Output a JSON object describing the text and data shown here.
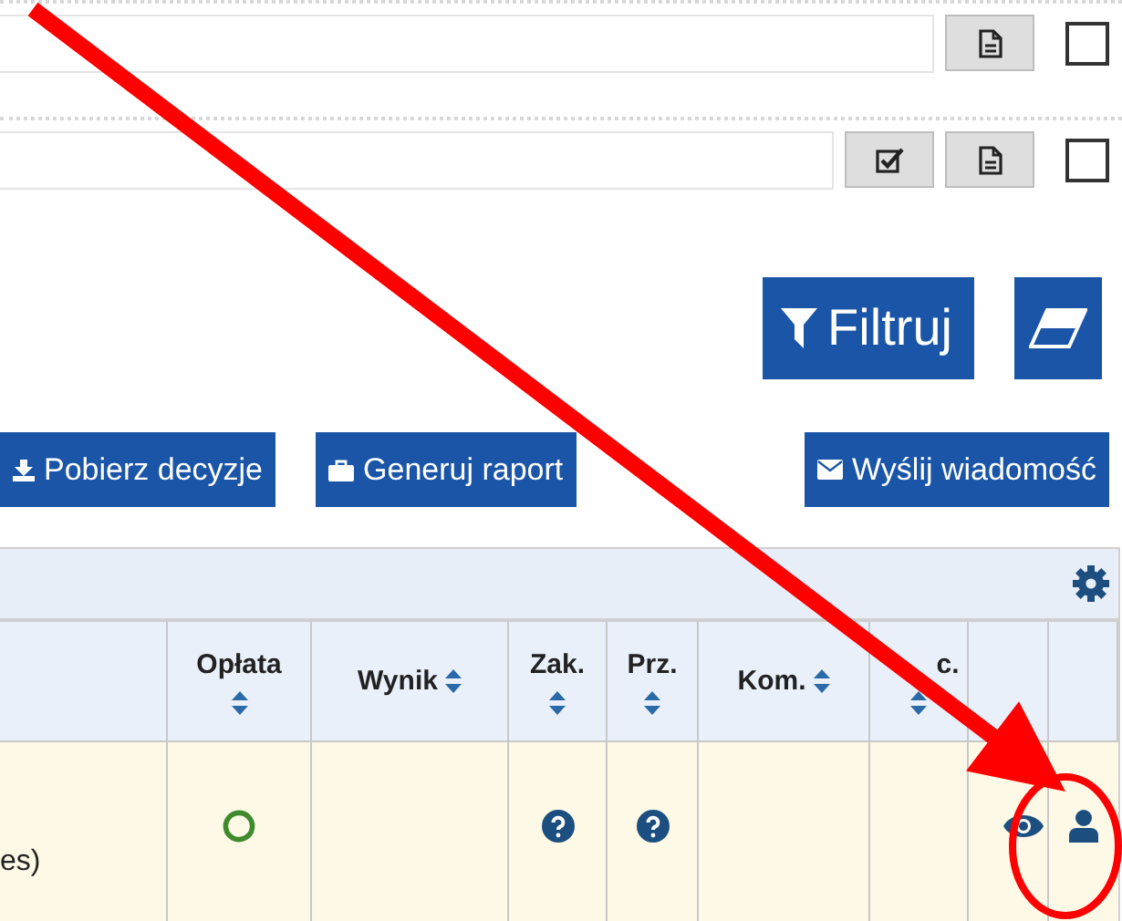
{
  "filter_rows": [
    {
      "actions": [
        {
          "kind": "document"
        }
      ],
      "checked": false
    },
    {
      "actions": [
        {
          "kind": "checklist"
        },
        {
          "kind": "document"
        }
      ],
      "checked": false
    }
  ],
  "filter_button": {
    "label": "Filtruj"
  },
  "action_buttons": [
    {
      "label": "Pobierz decyzje",
      "kind": "download"
    },
    {
      "label": "Generuj raport",
      "kind": "report"
    },
    {
      "label": "Wyślij wiadomość",
      "kind": "message"
    }
  ],
  "table": {
    "columns": [
      {
        "kind": "blank"
      },
      {
        "kind": "sortable_stacked",
        "label": "Opłata"
      },
      {
        "kind": "sortable_inline",
        "label": "Wynik"
      },
      {
        "kind": "sortable_stacked",
        "label": "Zak."
      },
      {
        "kind": "sortable_stacked",
        "label": "Prz."
      },
      {
        "kind": "sortable_inline",
        "label": "Kom."
      },
      {
        "kind": "sortable_stacked",
        "label": "c."
      },
      {
        "kind": "blank"
      },
      {
        "kind": "blank"
      }
    ],
    "rows": [
      {
        "cells": [
          {
            "kind": "text",
            "text": "es)"
          },
          {
            "kind": "circle",
            "color": "#3f8a2c"
          },
          {
            "kind": "empty"
          },
          {
            "kind": "question"
          },
          {
            "kind": "question"
          },
          {
            "kind": "empty"
          },
          {
            "kind": "empty"
          },
          {
            "kind": "view"
          },
          {
            "kind": "user"
          }
        ]
      }
    ]
  },
  "annotation": {
    "kind": "arrow_and_circle"
  }
}
